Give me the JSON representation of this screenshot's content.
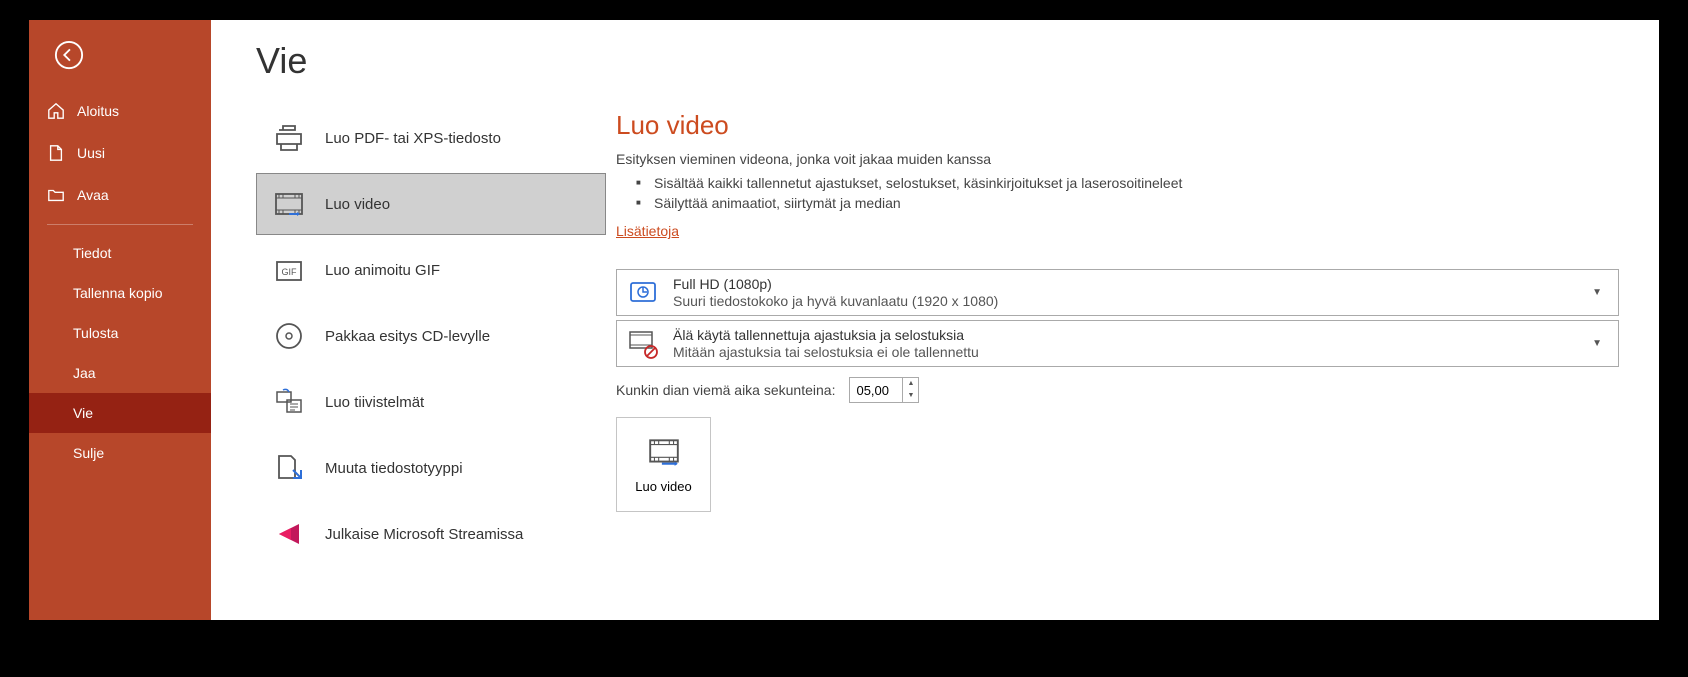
{
  "sidebar": {
    "items": [
      {
        "label": "Aloitus"
      },
      {
        "label": "Uusi"
      },
      {
        "label": "Avaa"
      },
      {
        "label": "Tiedot"
      },
      {
        "label": "Tallenna kopio"
      },
      {
        "label": "Tulosta"
      },
      {
        "label": "Jaa"
      },
      {
        "label": "Vie"
      },
      {
        "label": "Sulje"
      }
    ]
  },
  "middle": {
    "title": "Vie",
    "options": [
      {
        "label": "Luo PDF- tai XPS-tiedosto"
      },
      {
        "label": "Luo video"
      },
      {
        "label": "Luo animoitu GIF"
      },
      {
        "label": "Pakkaa esitys CD-levylle"
      },
      {
        "label": "Luo tiivistelmät"
      },
      {
        "label": "Muuta tiedostotyyppi"
      },
      {
        "label": "Julkaise Microsoft Streamissa"
      }
    ]
  },
  "main": {
    "heading": "Luo video",
    "description": "Esityksen vieminen videona, jonka voit jakaa muiden kanssa",
    "bullets": [
      "Sisältää kaikki tallennetut ajastukset, selostukset, käsinkirjoitukset ja laserosoitineleet",
      "Säilyttää animaatiot, siirtymät ja median"
    ],
    "learn_more": "Lisätietoja",
    "quality": {
      "title": "Full HD (1080p)",
      "sub": "Suuri tiedostokoko ja hyvä kuvanlaatu (1920 x 1080)"
    },
    "timings": {
      "title": "Älä käytä tallennettuja ajastuksia ja selostuksia",
      "sub": "Mitään ajastuksia tai selostuksia ei ole tallennettu"
    },
    "seconds_label": "Kunkin dian viemä aika sekunteina:",
    "seconds_value": "05,00",
    "create_button": "Luo video"
  }
}
